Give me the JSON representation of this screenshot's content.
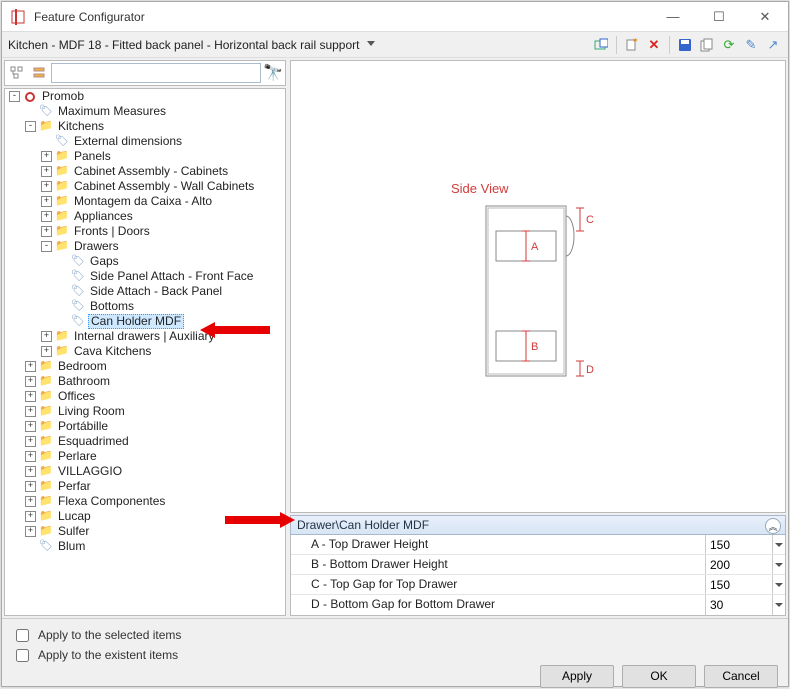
{
  "window": {
    "title": "Feature Configurator"
  },
  "breadcrumb": "Kitchen - MDF 18 - Fitted back panel - Horizontal back rail support",
  "search": {
    "placeholder": ""
  },
  "tree": {
    "root": "Promob",
    "root_items": {
      "max_measures": "Maximum Measures",
      "kitchens": "Kitchens",
      "kitchens_items": {
        "ext_dim": "External dimensions",
        "panels": "Panels",
        "cab_asm": "Cabinet Assembly - Cabinets",
        "cab_asm_wall": "Cabinet Assembly - Wall Cabinets",
        "montagem": "Montagem da Caixa - Alto",
        "appliances": "Appliances",
        "fronts": "Fronts | Doors",
        "drawers": "Drawers",
        "drawers_items": {
          "gaps": "Gaps",
          "side_panel_attach": "Side Panel Attach - Front Face",
          "side_attach_back": "Side Attach - Back Panel",
          "bottoms": "Bottoms",
          "can_holder": "Can Holder MDF"
        },
        "internal_drawers": "Internal drawers | Auxiliary",
        "cava": "Cava Kitchens"
      },
      "bedroom": "Bedroom",
      "bathroom": "Bathroom",
      "offices": "Offices",
      "living": "Living Room",
      "portabille": "Portábille",
      "esquadrimed": "Esquadrimed",
      "perlare": "Perlare",
      "villaggio": "VILLAGGIO",
      "perfar": "Perfar",
      "flexa": "Flexa Componentes",
      "lucap": "Lucap",
      "sulfer": "Sulfer",
      "blum": "Blum"
    }
  },
  "preview": {
    "side_view": "Side View",
    "dimA": "A",
    "dimB": "B",
    "dimC": "C",
    "dimD": "D"
  },
  "props": {
    "header": "Drawer\\Can Holder MDF",
    "rows": [
      {
        "label": "A - Top Drawer Height",
        "value": "150"
      },
      {
        "label": "B - Bottom Drawer Height",
        "value": "200"
      },
      {
        "label": "C - Top Gap for Top Drawer",
        "value": "150"
      },
      {
        "label": "D - Bottom Gap for Bottom Drawer",
        "value": "30"
      }
    ]
  },
  "footer": {
    "apply_selected": "Apply to the selected items",
    "apply_existent": "Apply to the existent items",
    "apply": "Apply",
    "ok": "OK",
    "cancel": "Cancel"
  }
}
